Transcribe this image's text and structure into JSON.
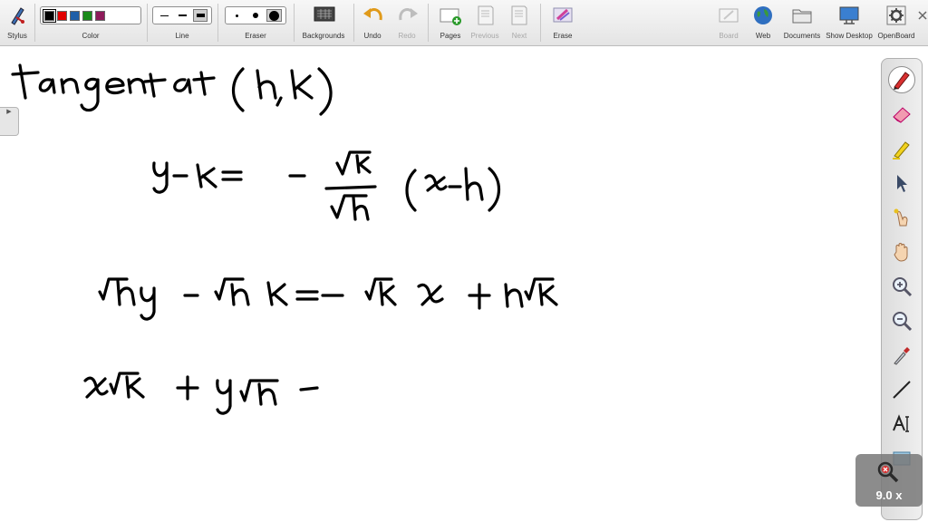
{
  "toolbar": {
    "stylus": "Stylus",
    "color": "Color",
    "line": "Line",
    "eraser": "Eraser",
    "backgrounds": "Backgrounds",
    "undo": "Undo",
    "redo": "Redo",
    "pages": "Pages",
    "previous": "Previous",
    "next": "Next",
    "erase": "Erase",
    "board": "Board",
    "web": "Web",
    "documents": "Documents",
    "show_desktop": "Show Desktop",
    "openboard": "OpenBoard"
  },
  "colors": [
    "#000000",
    "#e00000",
    "#1f5fa8",
    "#1a8a1a",
    "#8e1a5a"
  ],
  "selected_color": "#000000",
  "zoom": {
    "label": "9.0 x"
  },
  "palette_tools": [
    "pen-icon",
    "eraser-icon",
    "highlighter-icon",
    "pointer-icon",
    "laser-icon",
    "hand-icon",
    "zoom-in-icon",
    "zoom-out-icon",
    "pipette-icon",
    "line-icon",
    "text-icon",
    "capture-icon"
  ]
}
